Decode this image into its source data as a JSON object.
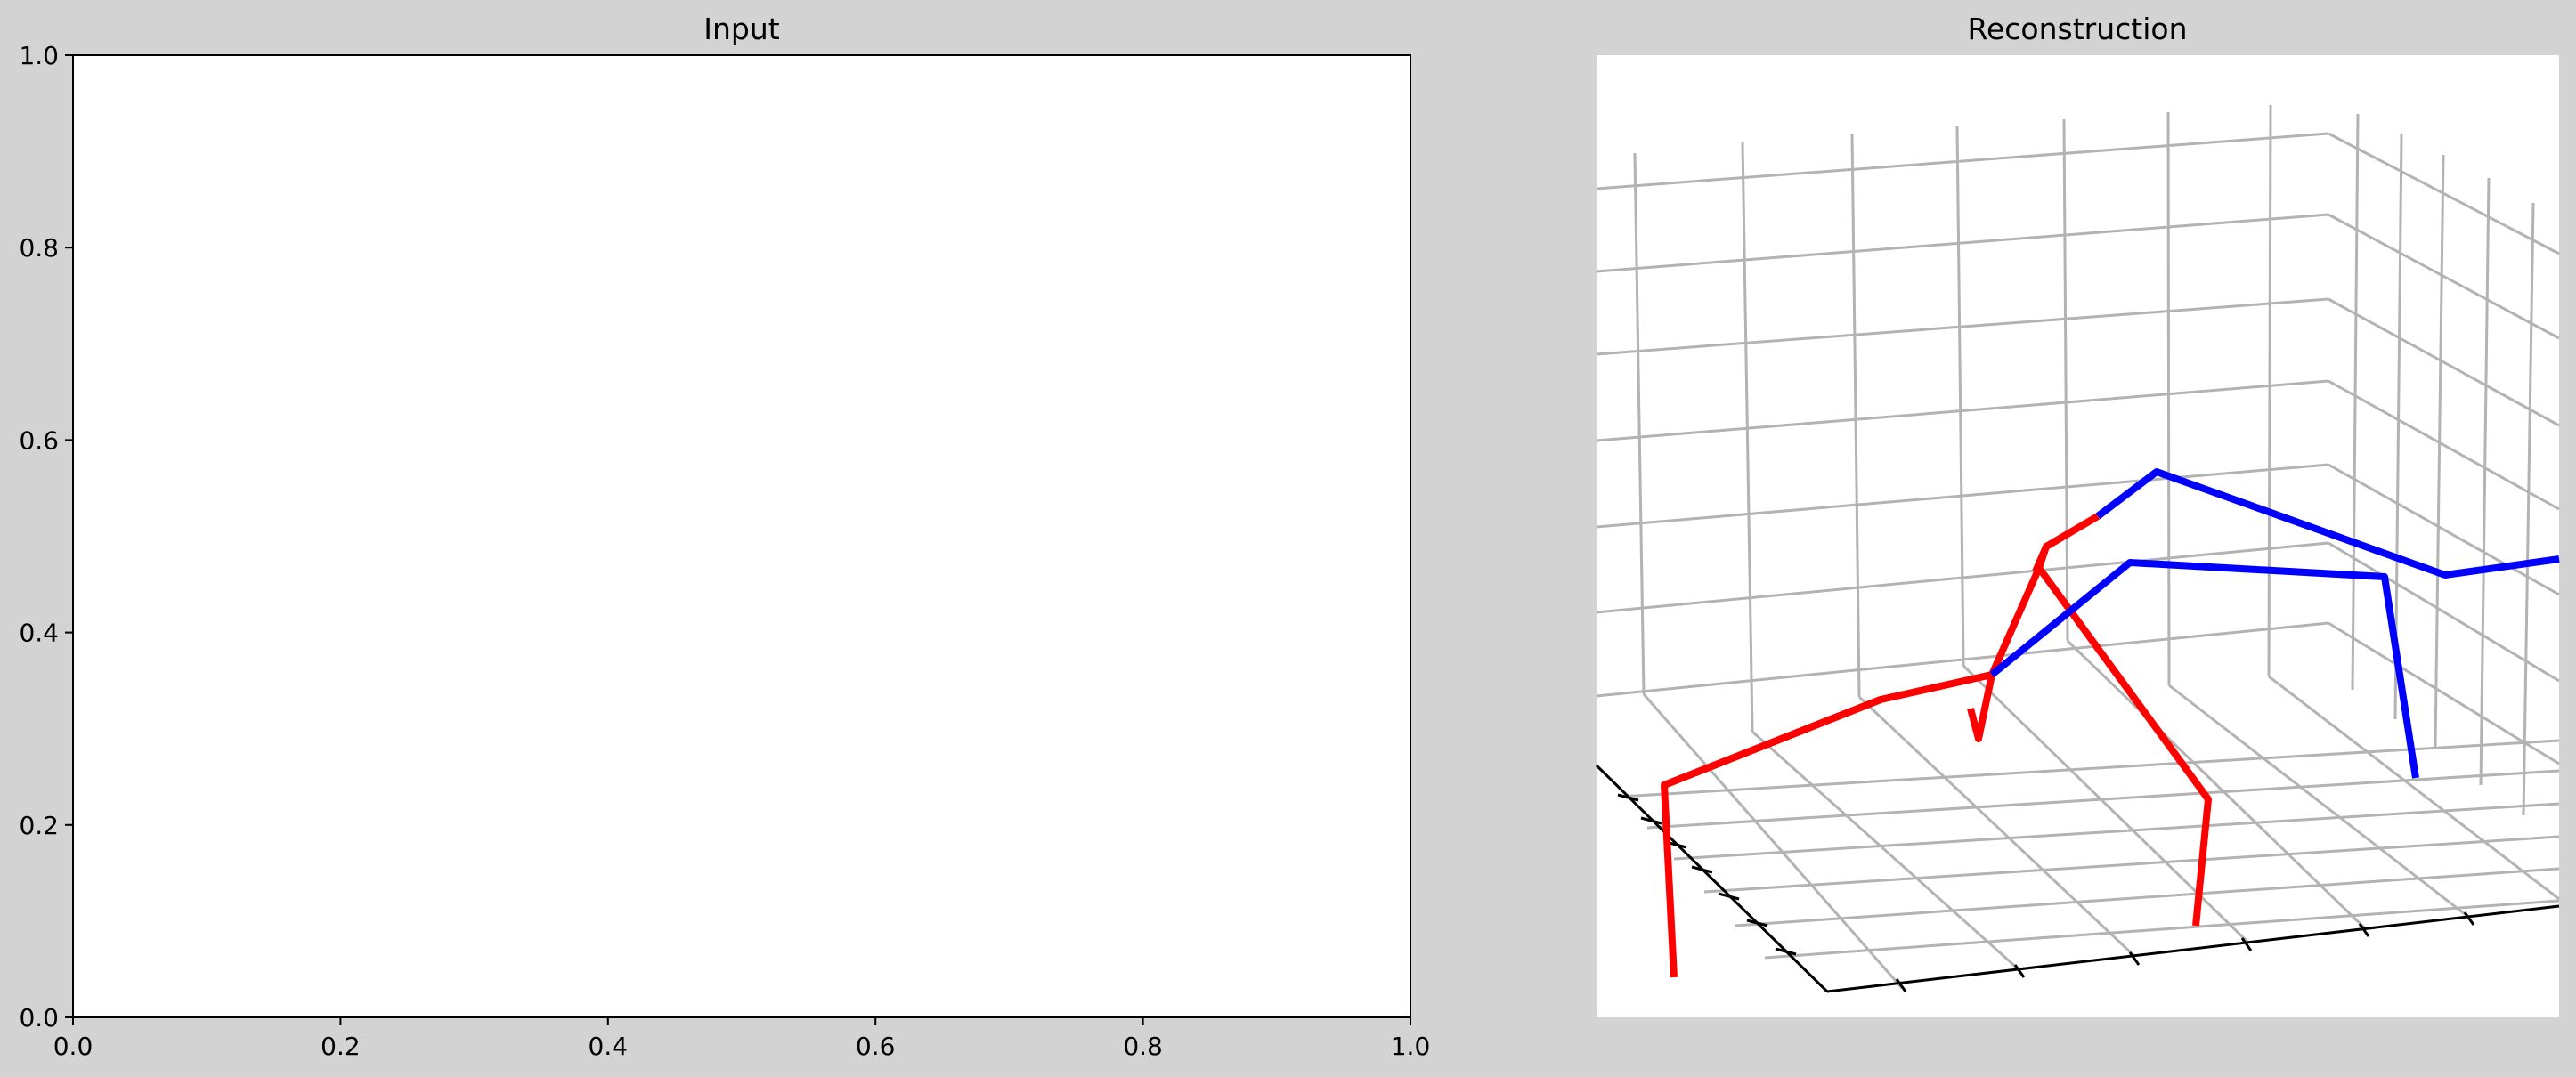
{
  "figure": {
    "background": "#d3d3d3"
  },
  "chart_data": [
    {
      "type": "line",
      "title": "Input",
      "xlim": [
        0.0,
        1.0
      ],
      "ylim": [
        0.0,
        1.0
      ],
      "x_ticks": [
        "0.0",
        "0.2",
        "0.4",
        "0.6",
        "0.8",
        "1.0"
      ],
      "y_ticks": [
        "0.0",
        "0.2",
        "0.4",
        "0.6",
        "0.8",
        "1.0"
      ],
      "series": [],
      "grid": false
    },
    {
      "type": "line",
      "title": "Reconstruction",
      "projection": "3d",
      "grid": true,
      "tick_labels_shown": false,
      "colors": {
        "left_limbs": "#ff0000",
        "right_limbs": "#0000ff",
        "grid": "#b3b3b3",
        "axis_line": "#000000",
        "pane": "#ffffff"
      },
      "series": [
        {
          "color": "#ff0000",
          "segments": 10
        },
        {
          "color": "#0000ff",
          "segments": 6
        }
      ]
    }
  ]
}
